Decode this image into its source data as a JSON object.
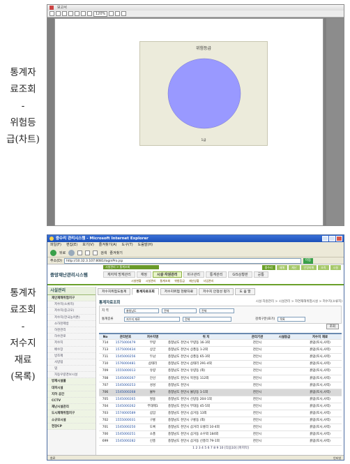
{
  "captions": {
    "first": [
      "통계자",
      "료조회",
      "-",
      "위험등",
      "급(차트)"
    ],
    "second": [
      "통계자",
      "료조회",
      "-",
      "저수지",
      "재료",
      "(목록)"
    ]
  },
  "viewer": {
    "title": "보고서",
    "zoom": "120%",
    "chart": {
      "title": "위험등급",
      "slice_label": "1급",
      "color": "#9999ff"
    }
  },
  "chart_data": {
    "type": "pie",
    "title": "위험등급",
    "categories": [
      "1급"
    ],
    "values": [
      100
    ]
  },
  "browser": {
    "title": "중수리 관리시스템 - Microsoft Internet Explorer",
    "menu": [
      "파일(F)",
      "편집(E)",
      "보기(V)",
      "즐겨찾기(A)",
      "도구(T)",
      "도움말(H)"
    ],
    "toolbar": [
      "뒤로",
      "검색",
      "즐겨찾기"
    ],
    "address_label": "주소(D)",
    "address": "http://10.32.3.107:8081/loginPro.jsp",
    "go_label": "이동",
    "status_done": "완료",
    "status_zone": "인터넷"
  },
  "app": {
    "logo": "중앙재난관리시스템",
    "top_strip": "시설관리 > 통계조회",
    "main_menu": [
      "재자체 방재관리",
      "재정",
      "시설·자원관리",
      "비구관리",
      "통계관리",
      "GIS상황판",
      "공통"
    ],
    "active_menu_index": 2,
    "right_tabs": [
      "중수리",
      "재해",
      "재난",
      "인명피해",
      "조직",
      "시설"
    ],
    "sub_menu": [
      "시설현황",
      "시설관리",
      "통계조회",
      "위험등급",
      "재난상황",
      "사업관리"
    ]
  },
  "sidebar": {
    "head": "시설관리",
    "items": [
      {
        "label": "재인재해위험지구",
        "level": "top"
      },
      {
        "label": "저수지(소류지)",
        "level": "sub"
      },
      {
        "label": "저수지(중규모)",
        "level": "sub"
      },
      {
        "label": "저수지(한국농어촌)",
        "level": "sub"
      },
      {
        "label": "소하천제방",
        "level": "sub"
      },
      {
        "label": "하천관리",
        "level": "sub"
      },
      {
        "label": "하수관로",
        "level": "sub"
      },
      {
        "label": "저수지",
        "level": "sub"
      },
      {
        "label": "배수장",
        "level": "sub"
      },
      {
        "label": "방조제",
        "level": "sub"
      },
      {
        "label": "사방댐",
        "level": "sub"
      },
      {
        "label": "댐",
        "level": "sub"
      },
      {
        "label": "자동우량경보시설",
        "level": "sub"
      },
      {
        "label": "방재시설물",
        "level": "top"
      },
      {
        "label": "대피시설",
        "level": "top"
      },
      {
        "label": "지하 공간",
        "level": "top"
      },
      {
        "label": "CCTV",
        "level": "top"
      },
      {
        "label": "재난시설관리",
        "level": "top"
      },
      {
        "label": "도시재해위험지구",
        "level": "top"
      },
      {
        "label": "소규모시설",
        "level": "top"
      },
      {
        "label": "현장CP",
        "level": "top"
      }
    ]
  },
  "content": {
    "tabs": [
      "저수지위험도통계",
      "통계자료조회",
      "저수지위험 현황자료",
      "저수지 안정성 평가",
      "도 움 말"
    ],
    "active_tab_index": 1,
    "section_title": "통계자료조회",
    "breadcrumb": "시설·자원관리 > 시설관리 > 자연재해위험시설 > 저수지(소류지)",
    "filter": {
      "row1": {
        "label": "지 역",
        "selects": [
          "충청남도",
          "전체",
          "전체"
        ]
      },
      "row2": {
        "label": "통계종류",
        "selects": [
          "저수지 재료",
          "전체"
        ],
        "label2": "검색구분(표기)",
        "select2": "목록"
      },
      "search_label": "조회"
    },
    "columns": [
      "No",
      "관리번호",
      "저수지명",
      "위 치",
      "관리기관",
      "시설등급",
      "저수지 재료"
    ],
    "rows": [
      [
        "714",
        "1575000479",
        "무량",
        "충청남도 천안시 무량동 16-3외",
        "천안시",
        "",
        "흙댐(토사,사력)"
      ],
      [
        "713",
        "1575000434",
        "상궁",
        "충청남도 천안시 상풍동 1-2외",
        "천안시",
        "",
        "흙댐(토사,사력)"
      ],
      [
        "711",
        "1545000256",
        "두남",
        "충청남도 천안시 상풍동 65-3외",
        "천안시",
        "",
        "흙댐(토사,사력)"
      ],
      [
        "710",
        "1576000481",
        "삼태리",
        "충청남도 천안시 삼태리 291-4외",
        "천안시",
        "",
        "흙댐(토사,사력)"
      ],
      [
        "709",
        "1555000013",
        "유량",
        "충청남도 천안시 유량동 (외)",
        "천안시",
        "",
        "흙댐(토사,사력)"
      ],
      [
        "708",
        "1545000267",
        "안선",
        "충청남도 천안시 목천동 112외",
        "천안시",
        "",
        "흙댐(토사,사력)"
      ],
      [
        "707",
        "1545000253",
        "성성",
        "충청남도 천안시",
        "천안시",
        "",
        "흙댐(토사,사력)"
      ],
      [
        "706",
        "1545000268",
        "불투",
        "충청남도 천안시 불당동 1-1외",
        "천안시",
        "",
        "흙댐(토사,사력)"
      ],
      [
        "705",
        "1545000265",
        "쌍용",
        "충청남도 천안시 신방동 204-1외",
        "천안시",
        "",
        "흙댐(토사,사력)"
      ],
      [
        "704",
        "1545000262",
        "부대제1",
        "충청남도 천안시 부대동 45-5외",
        "천안시",
        "",
        "흙댐(토사,사력)"
      ],
      [
        "703",
        "1574000589",
        "삼암",
        "충청남도 천안시 삼거동 13외",
        "천안시",
        "",
        "흙댐(토사,사력)"
      ],
      [
        "702",
        "1555000031",
        "구룡",
        "충청남도 천안시 구룡동 (외)",
        "천안시",
        "",
        "흙댐(토사,사력)"
      ],
      [
        "701",
        "1545000250",
        "도록",
        "충청남도 천안시 삼거리 오룡리 10-4외",
        "천안시",
        "",
        "흙댐(토사,사력)"
      ],
      [
        "700",
        "1545000251",
        "소풍",
        "충청남도 천안시 삼거동 소우외 184외",
        "천안시",
        "",
        "흙댐(토사,사력)"
      ],
      [
        "699",
        "1545000282",
        "신흥",
        "충청남도 천안시 삼거동 신흥리 79-1외",
        "천안시",
        "",
        "흙댐(토사,사력)"
      ]
    ],
    "highlight_row_index": 7,
    "pager": "1 2 3 4 5 6 7 8 9 10 [다음10] [마지막]"
  }
}
